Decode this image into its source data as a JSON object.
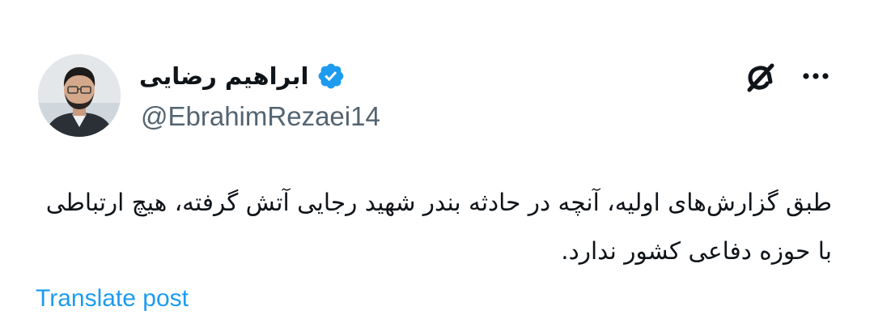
{
  "author": {
    "display_name": "ابراهیم رضایی",
    "handle": "@EbrahimRezaei14",
    "verified": true,
    "avatar_icon": "profile-photo"
  },
  "header_actions": {
    "grok_icon": "grok-icon",
    "more_icon": "more-options-icon"
  },
  "tweet": {
    "text": "طبق گزارش‌های اولیه، آنچه در حادثه بندر شهید رجایی آتش گرفته، هیچ ارتباطی با حوزه دفاعی کشور ندارد."
  },
  "translate": {
    "label": "Translate post"
  },
  "colors": {
    "text_primary": "#0f1419",
    "text_secondary": "#536471",
    "link": "#1d9bf0",
    "verified_badge": "#1d9bf0"
  }
}
